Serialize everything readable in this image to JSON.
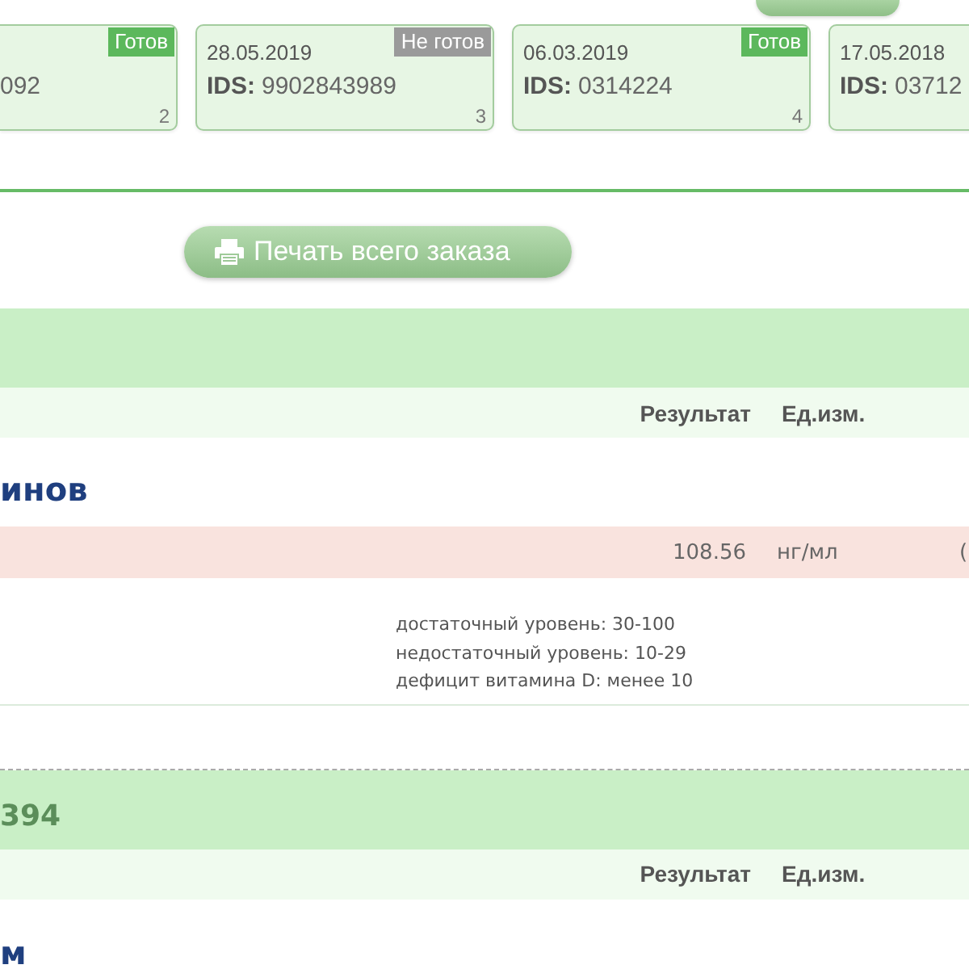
{
  "orders": [
    {
      "ids": "092",
      "status": "Готов",
      "ready": true,
      "number": "2"
    },
    {
      "date": "28.05.2019",
      "ids_label": "IDS:",
      "ids": "9902843989",
      "status": "Не готов",
      "ready": false,
      "number": "3"
    },
    {
      "date": "06.03.2019",
      "ids_label": "IDS:",
      "ids": "0314224",
      "status": "Готов",
      "ready": true,
      "number": "4"
    },
    {
      "date": "17.05.2018",
      "ids_label": "IDS:",
      "ids": "03712"
    }
  ],
  "print_button": {
    "label": "Печать всего заказа"
  },
  "sections": [
    {
      "columns": [
        "Результат",
        "Ед.изм."
      ],
      "groups": [
        {
          "title": "инов",
          "rows": [
            {
              "result": "108.56",
              "unit": "нг/мл",
              "column_3": "(",
              "flagged": true,
              "reference": [
                "достаточный уровень: 30-100",
                "недостаточный уровень: 10-29",
                "дефицит витамина D: менее 10"
              ]
            }
          ]
        }
      ]
    },
    {
      "title": "394",
      "columns": [
        "Результат",
        "Ед.изм."
      ],
      "groups": [
        {
          "title": "м"
        }
      ]
    }
  ]
}
